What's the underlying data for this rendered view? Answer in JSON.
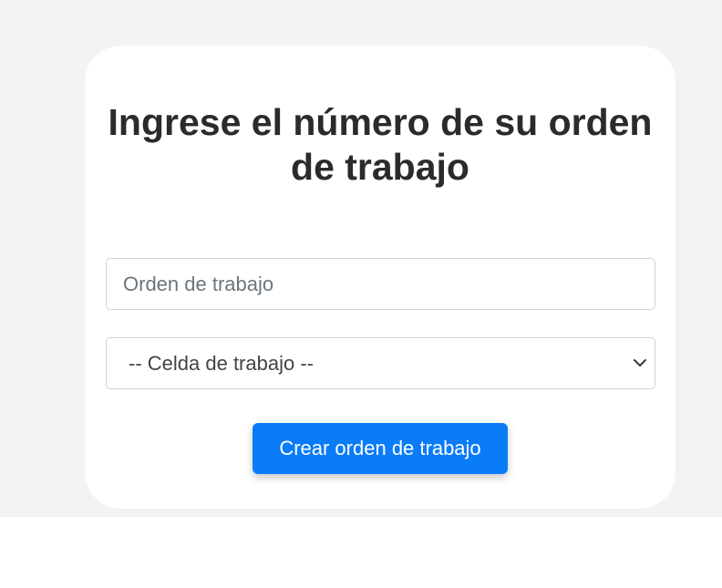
{
  "form": {
    "title": "Ingrese el número de su orden de trabajo",
    "order_input": {
      "value": "",
      "placeholder": "Orden de trabajo"
    },
    "cell_select": {
      "selected_label": "-- Celda de trabajo --",
      "icon": "chevron-down-icon"
    },
    "submit_label": "Crear orden de trabajo"
  },
  "colors": {
    "page_background": "#f3f3f3",
    "card_background": "#ffffff",
    "title_text": "#2b2b2b",
    "button_background": "#0a7cf8",
    "button_text": "#ffffff",
    "input_border": "#cfd3d7"
  }
}
